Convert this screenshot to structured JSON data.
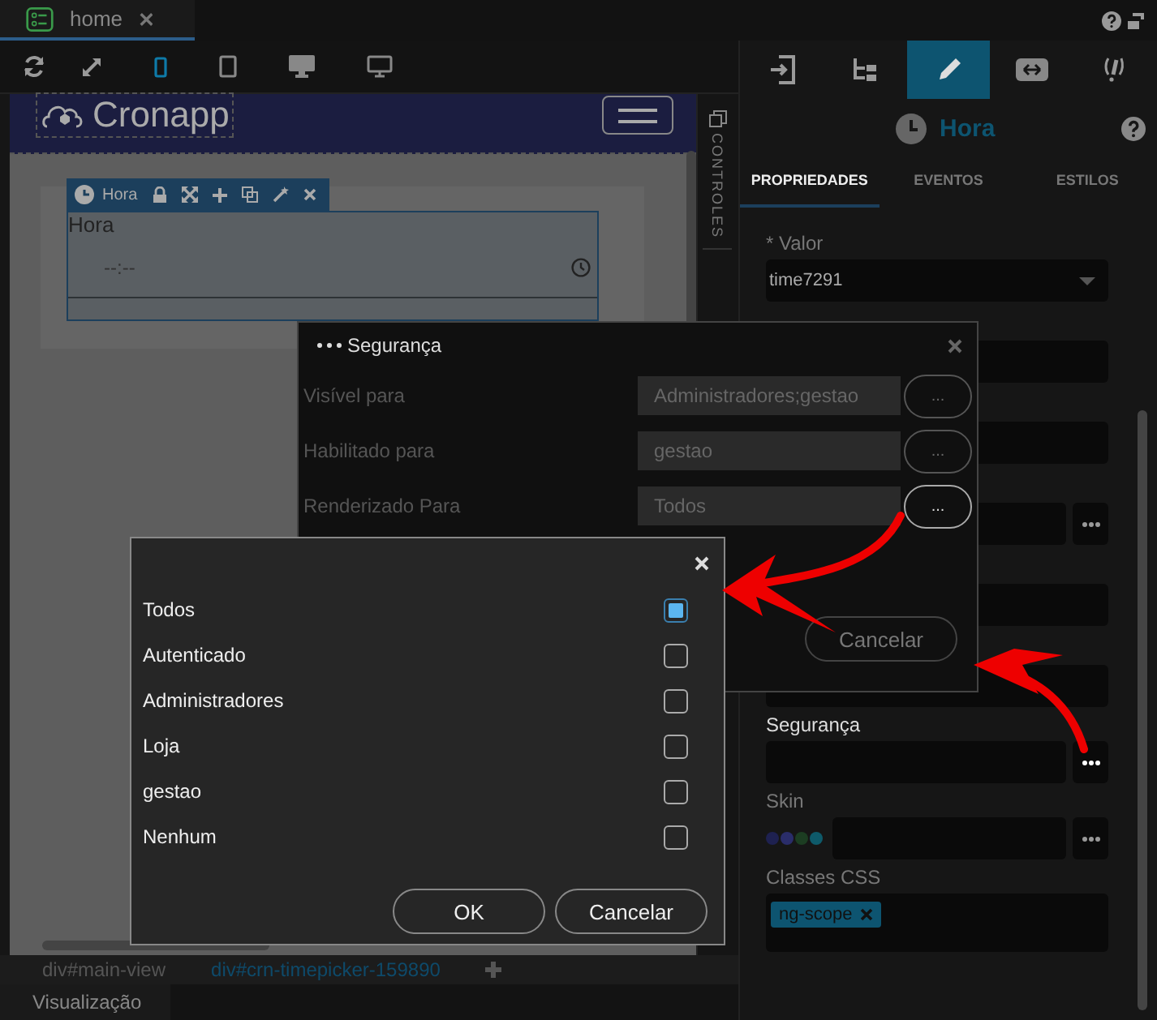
{
  "editor_tab": {
    "title": "home",
    "selected": true
  },
  "toolbar": {
    "tools": [
      {
        "kind": "refresh"
      },
      {
        "kind": "expand"
      }
    ],
    "devices": [
      {
        "kind": "phone",
        "selected": true
      },
      {
        "kind": "tablet",
        "selected": false
      },
      {
        "kind": "desktop",
        "selected": false
      },
      {
        "kind": "monitor",
        "selected": false
      }
    ]
  },
  "canvas": {
    "logo": "Cronapp",
    "component_toolbar": {
      "label": "Hora"
    },
    "time_field": {
      "label": "Hora",
      "placeholder": "--:--"
    }
  },
  "side_strip": {
    "label": "CONTROLES"
  },
  "breadcrumb": [
    {
      "label": "div#main-view",
      "selected": false
    },
    {
      "label": "div#crn-timepicker-159890",
      "selected": true
    }
  ],
  "bottom_tab": {
    "label": "Visualização"
  },
  "panel": {
    "icon_tabs": [
      {
        "kind": "exit",
        "selected": false
      },
      {
        "kind": "tree",
        "selected": false
      },
      {
        "kind": "pencil",
        "selected": true
      },
      {
        "kind": "resize",
        "selected": false
      },
      {
        "kind": "script",
        "selected": false
      }
    ],
    "title": "Hora",
    "tabs": [
      {
        "label": "PROPRIEDADES",
        "selected": true
      },
      {
        "label": "EVENTOS",
        "selected": false
      },
      {
        "label": "ESTILOS",
        "selected": false
      }
    ],
    "valor_label": "* Valor",
    "valor": "time7291",
    "seguranca_label": "Segurança",
    "skin_label": "Skin",
    "skin_colors": [
      {
        "color": "#1e2150"
      },
      {
        "color": "#2a2d6a"
      },
      {
        "color": "#1c3d22"
      },
      {
        "color": "#0e5a6a"
      }
    ],
    "css_label": "Classes CSS",
    "css_tags": [
      "ng-scope"
    ]
  },
  "security_dialog": {
    "title": "Segurança",
    "rows": [
      {
        "label": "Visível para",
        "value": "Administradores;gestao",
        "button": "..."
      },
      {
        "label": "Habilitado para",
        "value": "gestao",
        "button": "..."
      },
      {
        "label": "Renderizado Para",
        "value": "Todos",
        "button": "..."
      }
    ],
    "cancel": "Cancelar"
  },
  "roles_dialog": {
    "options": [
      {
        "label": "Todos",
        "checked": true
      },
      {
        "label": "Autenticado",
        "checked": false
      },
      {
        "label": "Administradores",
        "checked": false
      },
      {
        "label": "Loja",
        "checked": false
      },
      {
        "label": "gestao",
        "checked": false
      },
      {
        "label": "Nenhum",
        "checked": false
      }
    ],
    "ok": "OK",
    "cancel": "Cancelar"
  }
}
